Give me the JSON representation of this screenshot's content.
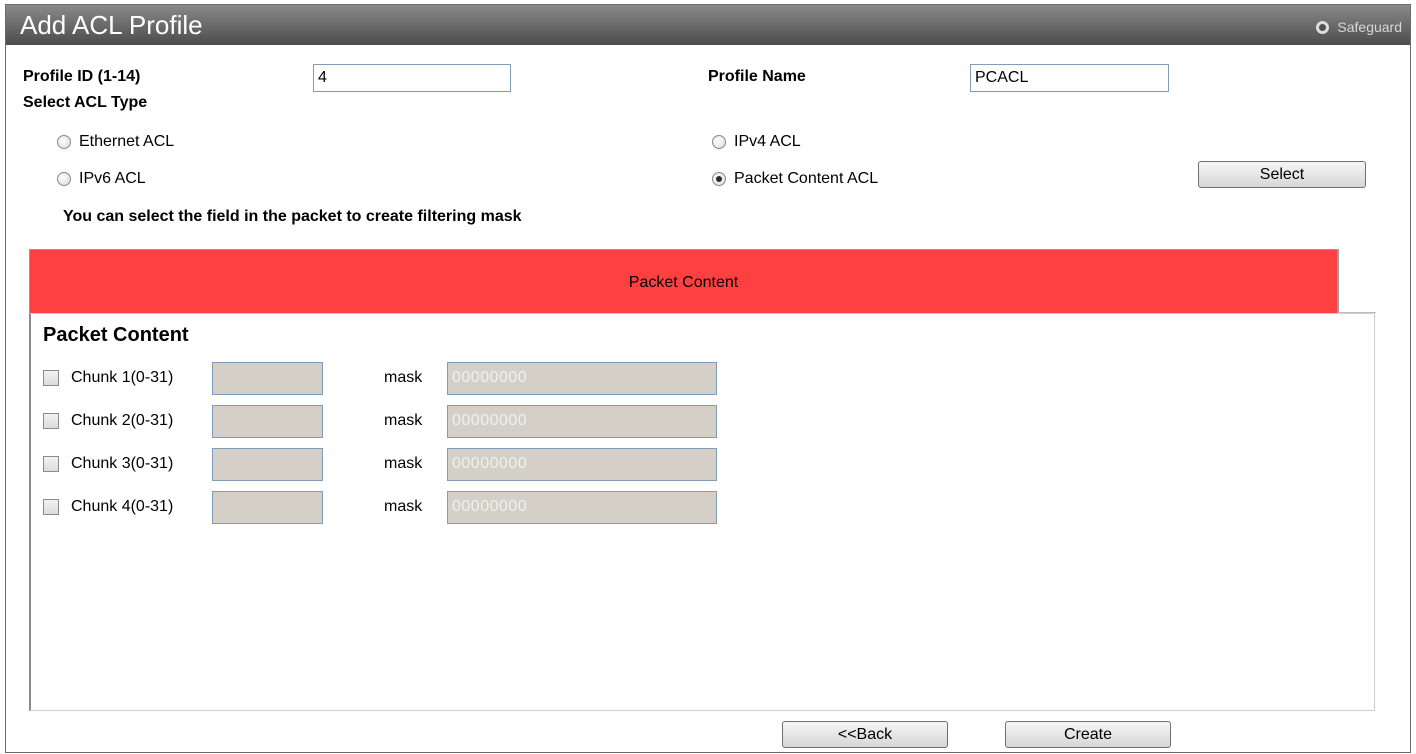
{
  "window": {
    "title": "Add ACL Profile",
    "safeguard_label": "Safeguard"
  },
  "form": {
    "profile_id_label": "Profile ID (1-14)",
    "profile_id_value": "4",
    "profile_name_label": "Profile Name",
    "profile_name_value": "PCACL",
    "select_acl_type_label": "Select ACL Type",
    "acl_types": [
      {
        "label": "Ethernet ACL",
        "selected": false
      },
      {
        "label": "IPv4 ACL",
        "selected": false
      },
      {
        "label": "IPv6 ACL",
        "selected": false
      },
      {
        "label": "Packet Content ACL",
        "selected": true
      }
    ],
    "select_button": "Select",
    "hint": "You can select the field in the packet to create filtering mask"
  },
  "tab": {
    "label": "Packet Content",
    "color": "#ff4040"
  },
  "packet_content": {
    "title": "Packet Content",
    "mask_label": "mask",
    "chunks": [
      {
        "label": "Chunk 1(0-31)",
        "value": "",
        "mask": "00000000",
        "checked": false
      },
      {
        "label": "Chunk 2(0-31)",
        "value": "",
        "mask": "00000000",
        "checked": false
      },
      {
        "label": "Chunk 3(0-31)",
        "value": "",
        "mask": "00000000",
        "checked": false
      },
      {
        "label": "Chunk 4(0-31)",
        "value": "",
        "mask": "00000000",
        "checked": false
      }
    ]
  },
  "footer": {
    "back_button": "<<Back",
    "create_button": "Create"
  }
}
